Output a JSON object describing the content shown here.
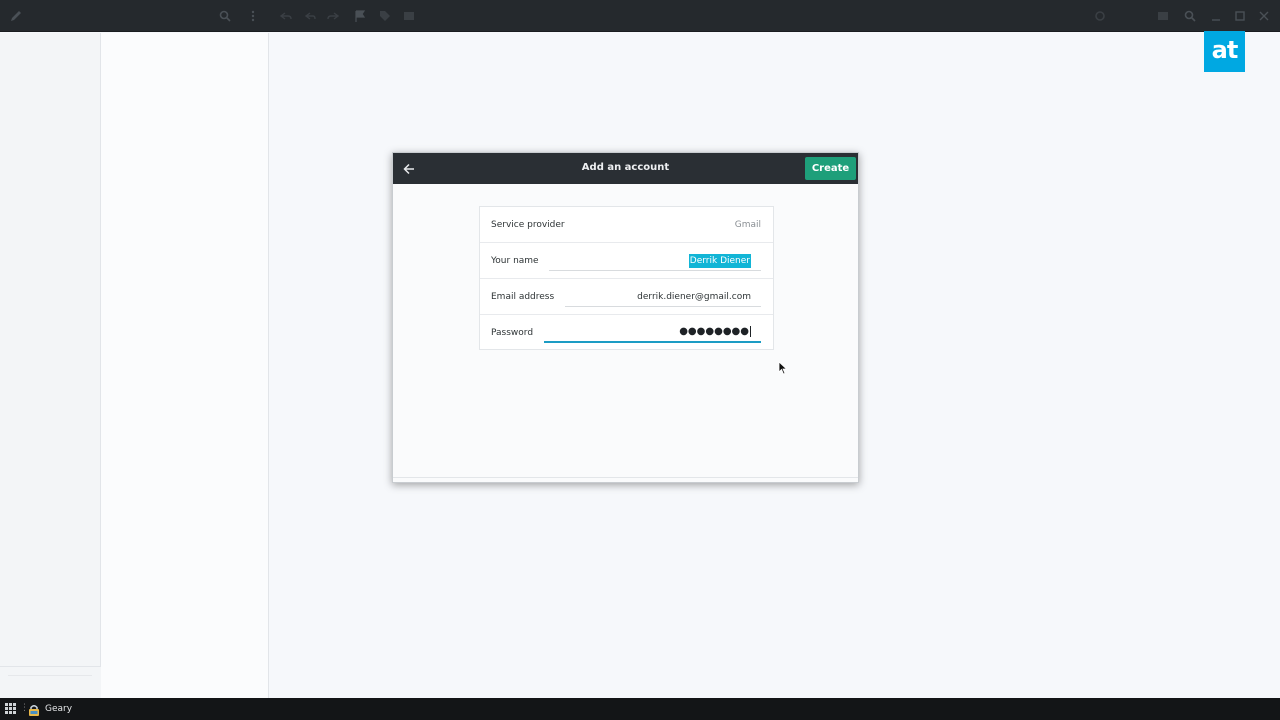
{
  "app": {
    "taskbar_label": "Geary"
  },
  "logo": {
    "text": "at",
    "color": "#00a8e2"
  },
  "toolbar": {
    "left_icons": [
      "pencil-icon",
      "search-icon",
      "menu-icon",
      "reply-icon",
      "reply-all-icon",
      "forward-icon",
      "flag-icon",
      "tag-icon",
      "archive-icon"
    ],
    "right_icons": [
      "settings-icon",
      "search-icon",
      "minimize-icon",
      "maximize-icon",
      "close-icon"
    ]
  },
  "dialog": {
    "title": "Add an account",
    "back_icon": "back-arrow-icon",
    "create_label": "Create",
    "create_color": "#1e9f7a",
    "fields": [
      {
        "label": "Service provider",
        "value": "Gmail"
      },
      {
        "label": "Your name",
        "value": "Derrik Diener"
      },
      {
        "label": "Email address",
        "value": "derrik.diener@gmail.com"
      },
      {
        "label": "Password",
        "value": "●●●●●●●●"
      }
    ]
  },
  "colors": {
    "header": "#2a2f34",
    "focus": "#1c9cc4",
    "selection": "#12b5d6"
  }
}
